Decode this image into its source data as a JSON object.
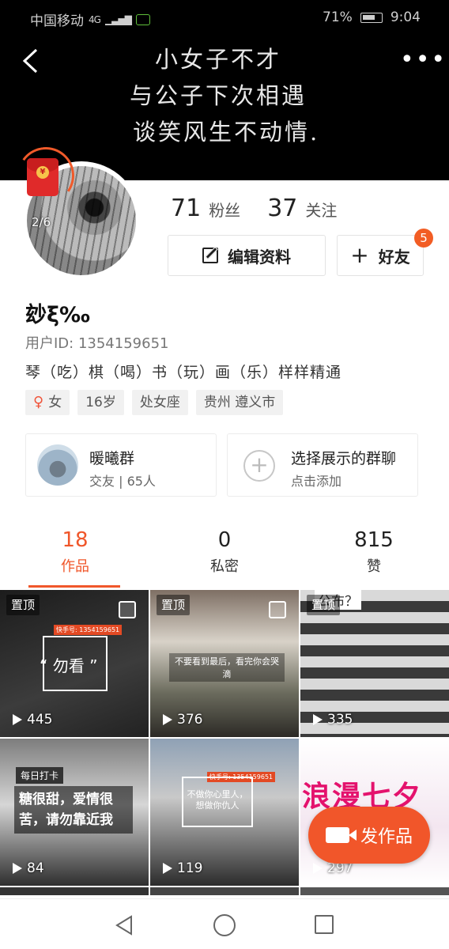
{
  "status_bar": {
    "carrier": "中国移动",
    "network": "4G",
    "battery": "71%",
    "time": "9:04"
  },
  "banner": {
    "lines": [
      "小女子不才",
      "与公子下次相遇",
      "谈笑风生不动情."
    ]
  },
  "avatar": {
    "redpack_count": "2/6"
  },
  "stats": {
    "followers_num": "71",
    "followers_label": "粉丝",
    "following_num": "37",
    "following_label": "关注"
  },
  "actions": {
    "edit_label": "编辑资料",
    "friend_label": "好友",
    "friend_badge": "5"
  },
  "profile": {
    "nickname": "玅ξ‰",
    "user_id": "用户ID: 1354159651",
    "bio": "琴（吃）棋（喝）书（玩）画（乐）样样精通",
    "tags": {
      "gender": "女",
      "age": "16岁",
      "zodiac": "处女座",
      "location": "贵州 遵义市"
    }
  },
  "groups": {
    "group_name": "暖曦群",
    "group_sub": "交友 | 65人",
    "add_title": "选择展示的群聊",
    "add_sub": "点击添加"
  },
  "tabs": {
    "works": {
      "num": "18",
      "label": "作品"
    },
    "private": {
      "num": "0",
      "label": "私密"
    },
    "likes": {
      "num": "815",
      "label": "赞"
    }
  },
  "tiles": [
    {
      "pinned": "置顶",
      "plays": "445",
      "overlay": "勿看",
      "stamp": "快手号: 1354159651"
    },
    {
      "pinned": "置顶",
      "plays": "376",
      "overlay": "不要看到最后，看完你会哭滴",
      "stamp": ""
    },
    {
      "pinned": "置顶",
      "plays": "335",
      "overlay": "公布？",
      "stamp": ""
    },
    {
      "pinned": "",
      "plays": "84",
      "overlay": "糖很甜，爱情很苦，请勿靠近我",
      "stamp": "每日打卡"
    },
    {
      "pinned": "",
      "plays": "119",
      "overlay": "不做你心里人，想做你仇人",
      "stamp": "快手号: 1354159651"
    },
    {
      "pinned": "",
      "plays": "297",
      "overlay": "浪漫七夕",
      "stamp": ""
    }
  ],
  "fab": {
    "label": "发作品"
  },
  "colors": {
    "accent": "#f0562a",
    "banner_bg": "#000000"
  }
}
